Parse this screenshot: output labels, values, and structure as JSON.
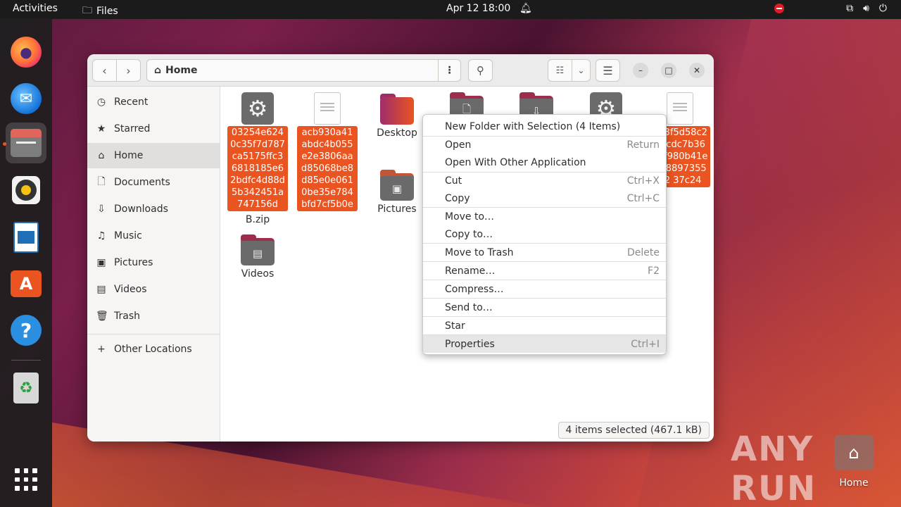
{
  "topbar": {
    "activities": "Activities",
    "app_name": "Files",
    "clock": "Apr 12  18:00"
  },
  "dock": {
    "items": [
      "firefox-icon",
      "thunderbird-icon",
      "files-icon",
      "rhythmbox-icon",
      "libreoffice-writer-icon",
      "software-icon",
      "help-icon",
      "trash-icon",
      "app-grid-icon"
    ]
  },
  "window": {
    "path": "Home",
    "status": "4 items selected  (467.1 kB)"
  },
  "sidebar": {
    "items": [
      {
        "label": "Recent",
        "icon": "clock-icon"
      },
      {
        "label": "Starred",
        "icon": "star-icon"
      },
      {
        "label": "Home",
        "icon": "home-icon"
      },
      {
        "label": "Documents",
        "icon": "document-icon"
      },
      {
        "label": "Downloads",
        "icon": "download-icon"
      },
      {
        "label": "Music",
        "icon": "music-icon"
      },
      {
        "label": "Pictures",
        "icon": "picture-icon"
      },
      {
        "label": "Videos",
        "icon": "video-icon"
      },
      {
        "label": "Trash",
        "icon": "trash-icon"
      },
      {
        "label": "Other Locations",
        "icon": "plus-icon"
      }
    ]
  },
  "files": {
    "f1_selected": "03254e6240c35f7d787ca5175ffc36818185e62bdfc4d88d5b342451a747156d",
    "f1_label": "B.zip",
    "f2_selected": "acb930a41abdc4b055e2e3806aad85068be8d85e0e0610be35e784bfd7cf5b0e",
    "desktop": "Desktop",
    "pictures": "Pictures",
    "videos": "Videos",
    "f7_selected": "503f5d58c21acdc7b36d8f980b41ef3f889735512 37c24"
  },
  "context_menu": {
    "items": [
      {
        "label": "New Folder with Selection (4 Items)",
        "accel": ""
      },
      {
        "label": "Open",
        "accel": "Return"
      },
      {
        "label": "Open With Other Application",
        "accel": ""
      },
      {
        "label": "Cut",
        "accel": "Ctrl+X"
      },
      {
        "label": "Copy",
        "accel": "Ctrl+C"
      },
      {
        "label": "Move to…",
        "accel": ""
      },
      {
        "label": "Copy to…",
        "accel": ""
      },
      {
        "label": "Move to Trash",
        "accel": "Delete"
      },
      {
        "label": "Rename…",
        "accel": "F2"
      },
      {
        "label": "Compress…",
        "accel": ""
      },
      {
        "label": "Send to…",
        "accel": ""
      },
      {
        "label": "Star",
        "accel": ""
      },
      {
        "label": "Properties",
        "accel": "Ctrl+I"
      }
    ]
  },
  "desktop": {
    "home_label": "Home",
    "watermark": "ANY RUN"
  }
}
